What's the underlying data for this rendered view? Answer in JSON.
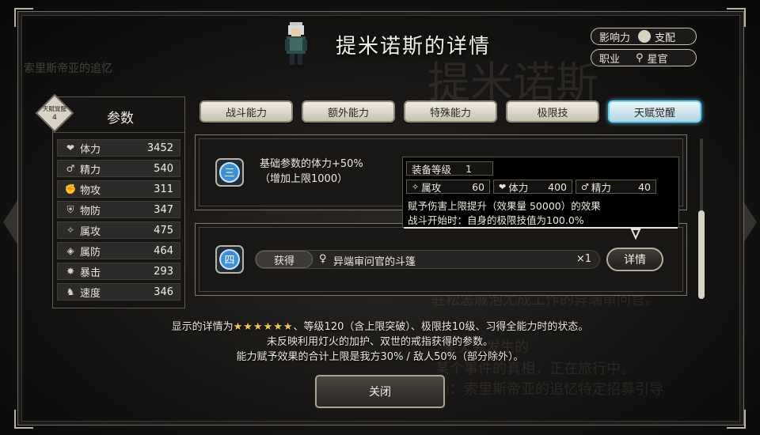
{
  "header": {
    "title": "提米诺斯的详情",
    "influence_label": "影响力",
    "influence_value": "支配",
    "job_label": "职业",
    "job_value": "星官"
  },
  "badge": {
    "line1": "天賦覚醒",
    "line2": "4"
  },
  "params": {
    "title": "参数",
    "stats": [
      {
        "icon": "heart-icon",
        "label": "体力",
        "value": "3452"
      },
      {
        "icon": "sp-icon",
        "label": "精力",
        "value": "540"
      },
      {
        "icon": "fist-icon",
        "label": "物攻",
        "value": "311"
      },
      {
        "icon": "shield-icon",
        "label": "物防",
        "value": "347"
      },
      {
        "icon": "wand-icon",
        "label": "属攻",
        "value": "475"
      },
      {
        "icon": "elemental-shield-icon",
        "label": "属防",
        "value": "464"
      },
      {
        "icon": "critical-icon",
        "label": "暴击",
        "value": "293"
      },
      {
        "icon": "boot-icon",
        "label": "速度",
        "value": "346"
      }
    ]
  },
  "tabs": [
    {
      "label": "战斗能力"
    },
    {
      "label": "额外能力"
    },
    {
      "label": "特殊能力"
    },
    {
      "label": "极限技"
    },
    {
      "label": "天赋觉醒"
    }
  ],
  "awaken3": {
    "tier": "三",
    "line1": "基础参数的体力+50%",
    "line2": "（增加上限1000）"
  },
  "tooltip": {
    "equip_label": "装备等级",
    "equip_value": "1",
    "stat1_label": "属攻",
    "stat1_value": "60",
    "stat2_label": "体力",
    "stat2_value": "400",
    "stat3_label": "精力",
    "stat3_value": "40",
    "effect1": "赋予伤害上限提升（效果量 50000）的效果",
    "effect2": "战斗开始时：自身的极限技值为100.0%"
  },
  "awaken4": {
    "tier": "四",
    "obtain_label": "获得",
    "item_name": "异端审问官的斗篷",
    "item_count": "×1",
    "detail_button": "详情"
  },
  "footer": {
    "line1_prefix": "显示的详情为",
    "stars": "★★★★★★",
    "line1_suffix": "、等级120（含上限突破）、极限技10级、习得全能力时的状态。",
    "line2": "未反映利用灯火的加护、双世的戒指获得的参数。",
    "line3": "能力赋予效果的合计上限是我方30% / 敌人50%（部分除外）。",
    "close_button": "关闭"
  },
  "colors": {
    "accent_active_tab": "#6fd0f0",
    "star": "#f2c94c",
    "tier_blue": "#3f8fd6"
  }
}
